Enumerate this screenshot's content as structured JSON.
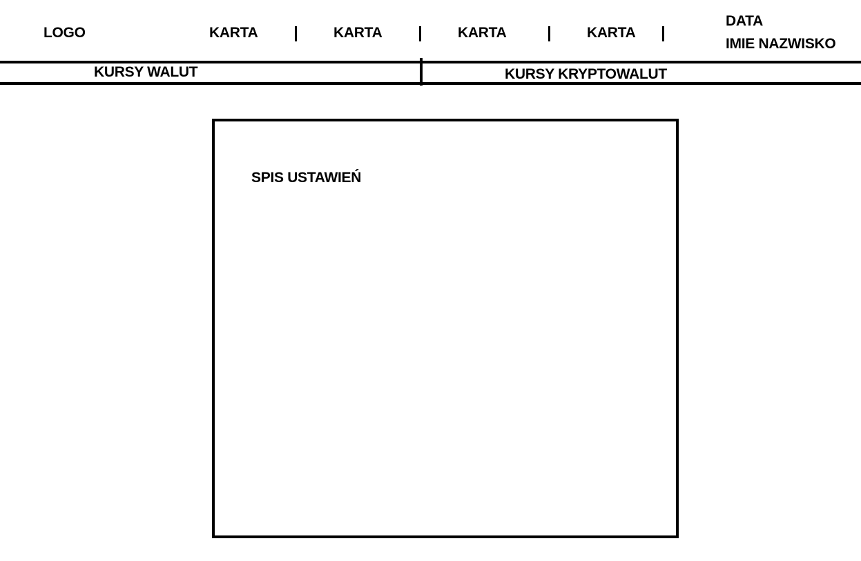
{
  "header": {
    "logo": "LOGO",
    "tabs": [
      {
        "label": "KARTA"
      },
      {
        "label": "KARTA"
      },
      {
        "label": "KARTA"
      },
      {
        "label": "KARTA"
      }
    ],
    "date": "DATA",
    "user_name": "IMIE NAZWISKO"
  },
  "subnav": {
    "left": "KURSY WALUT",
    "right": "KURSY KRYPTOWALUT"
  },
  "main": {
    "title": "SPIS USTAWIEŃ"
  }
}
